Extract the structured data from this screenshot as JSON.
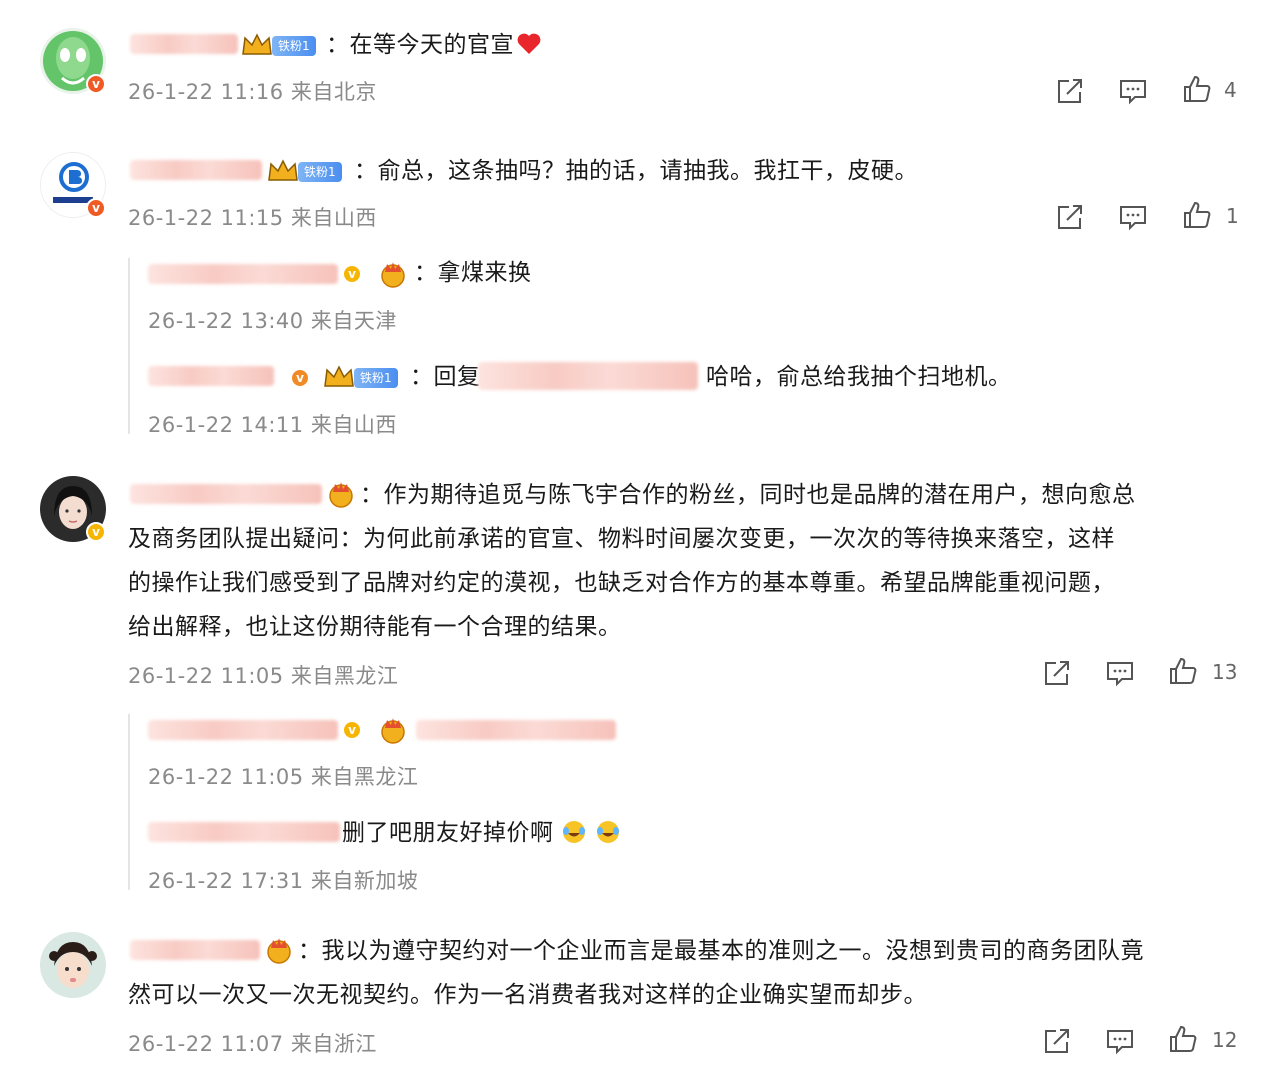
{
  "comments": [
    {
      "text": "在等今天的官宣",
      "fan_badge": "铁粉1",
      "time": "26-1-22 11:16",
      "location": "来自北京",
      "likes": "4"
    },
    {
      "text": "俞总，这条抽吗？抽的话，请抽我。我扛干，皮硬。",
      "fan_badge": "铁粉1",
      "time": "26-1-22 11:15",
      "location": "来自山西",
      "likes": "1",
      "replies": [
        {
          "text": "拿煤来换",
          "time": "26-1-22 13:40",
          "location": "来自天津"
        },
        {
          "prefix": "回复",
          "text": "哈哈，俞总给我抽个扫地机。",
          "fan_badge": "铁粉1",
          "time": "26-1-22 14:11",
          "location": "来自山西"
        }
      ]
    },
    {
      "lines": [
        "作为期待追觅与陈飞宇合作的粉丝，同时也是品牌的潜在用户，想向愈总",
        "及商务团队提出疑问：为何此前承诺的官宣、物料时间屡次变更，一次次的等待换来落空，这样",
        "的操作让我们感受到了品牌对约定的漠视，也缺乏对合作方的基本尊重。希望品牌能重视问题，",
        "给出解释，也让这份期待能有一个合理的结果。"
      ],
      "time": "26-1-22 11:05",
      "location": "来自黑龙江",
      "likes": "13",
      "replies": [
        {
          "text": "",
          "time": "26-1-22 11:05",
          "location": "来自黑龙江"
        },
        {
          "text": "删了吧朋友好掉价啊",
          "time": "26-1-22 17:31",
          "location": "来自新加坡"
        }
      ]
    },
    {
      "lines": [
        "我以为遵守契约对一个企业而言是最基本的准则之一。没想到贵司的商务团队竟",
        "然可以一次又一次无视契约。作为一名消费者我对这样的企业确实望而却步。"
      ],
      "time": "26-1-22 11:07",
      "location": "来自浙江",
      "likes": "12"
    }
  ],
  "separator": "：",
  "colors": {
    "accent_orange": "#f05a24",
    "gold": "#f7b500",
    "meta_gray": "#8a8a8a"
  }
}
